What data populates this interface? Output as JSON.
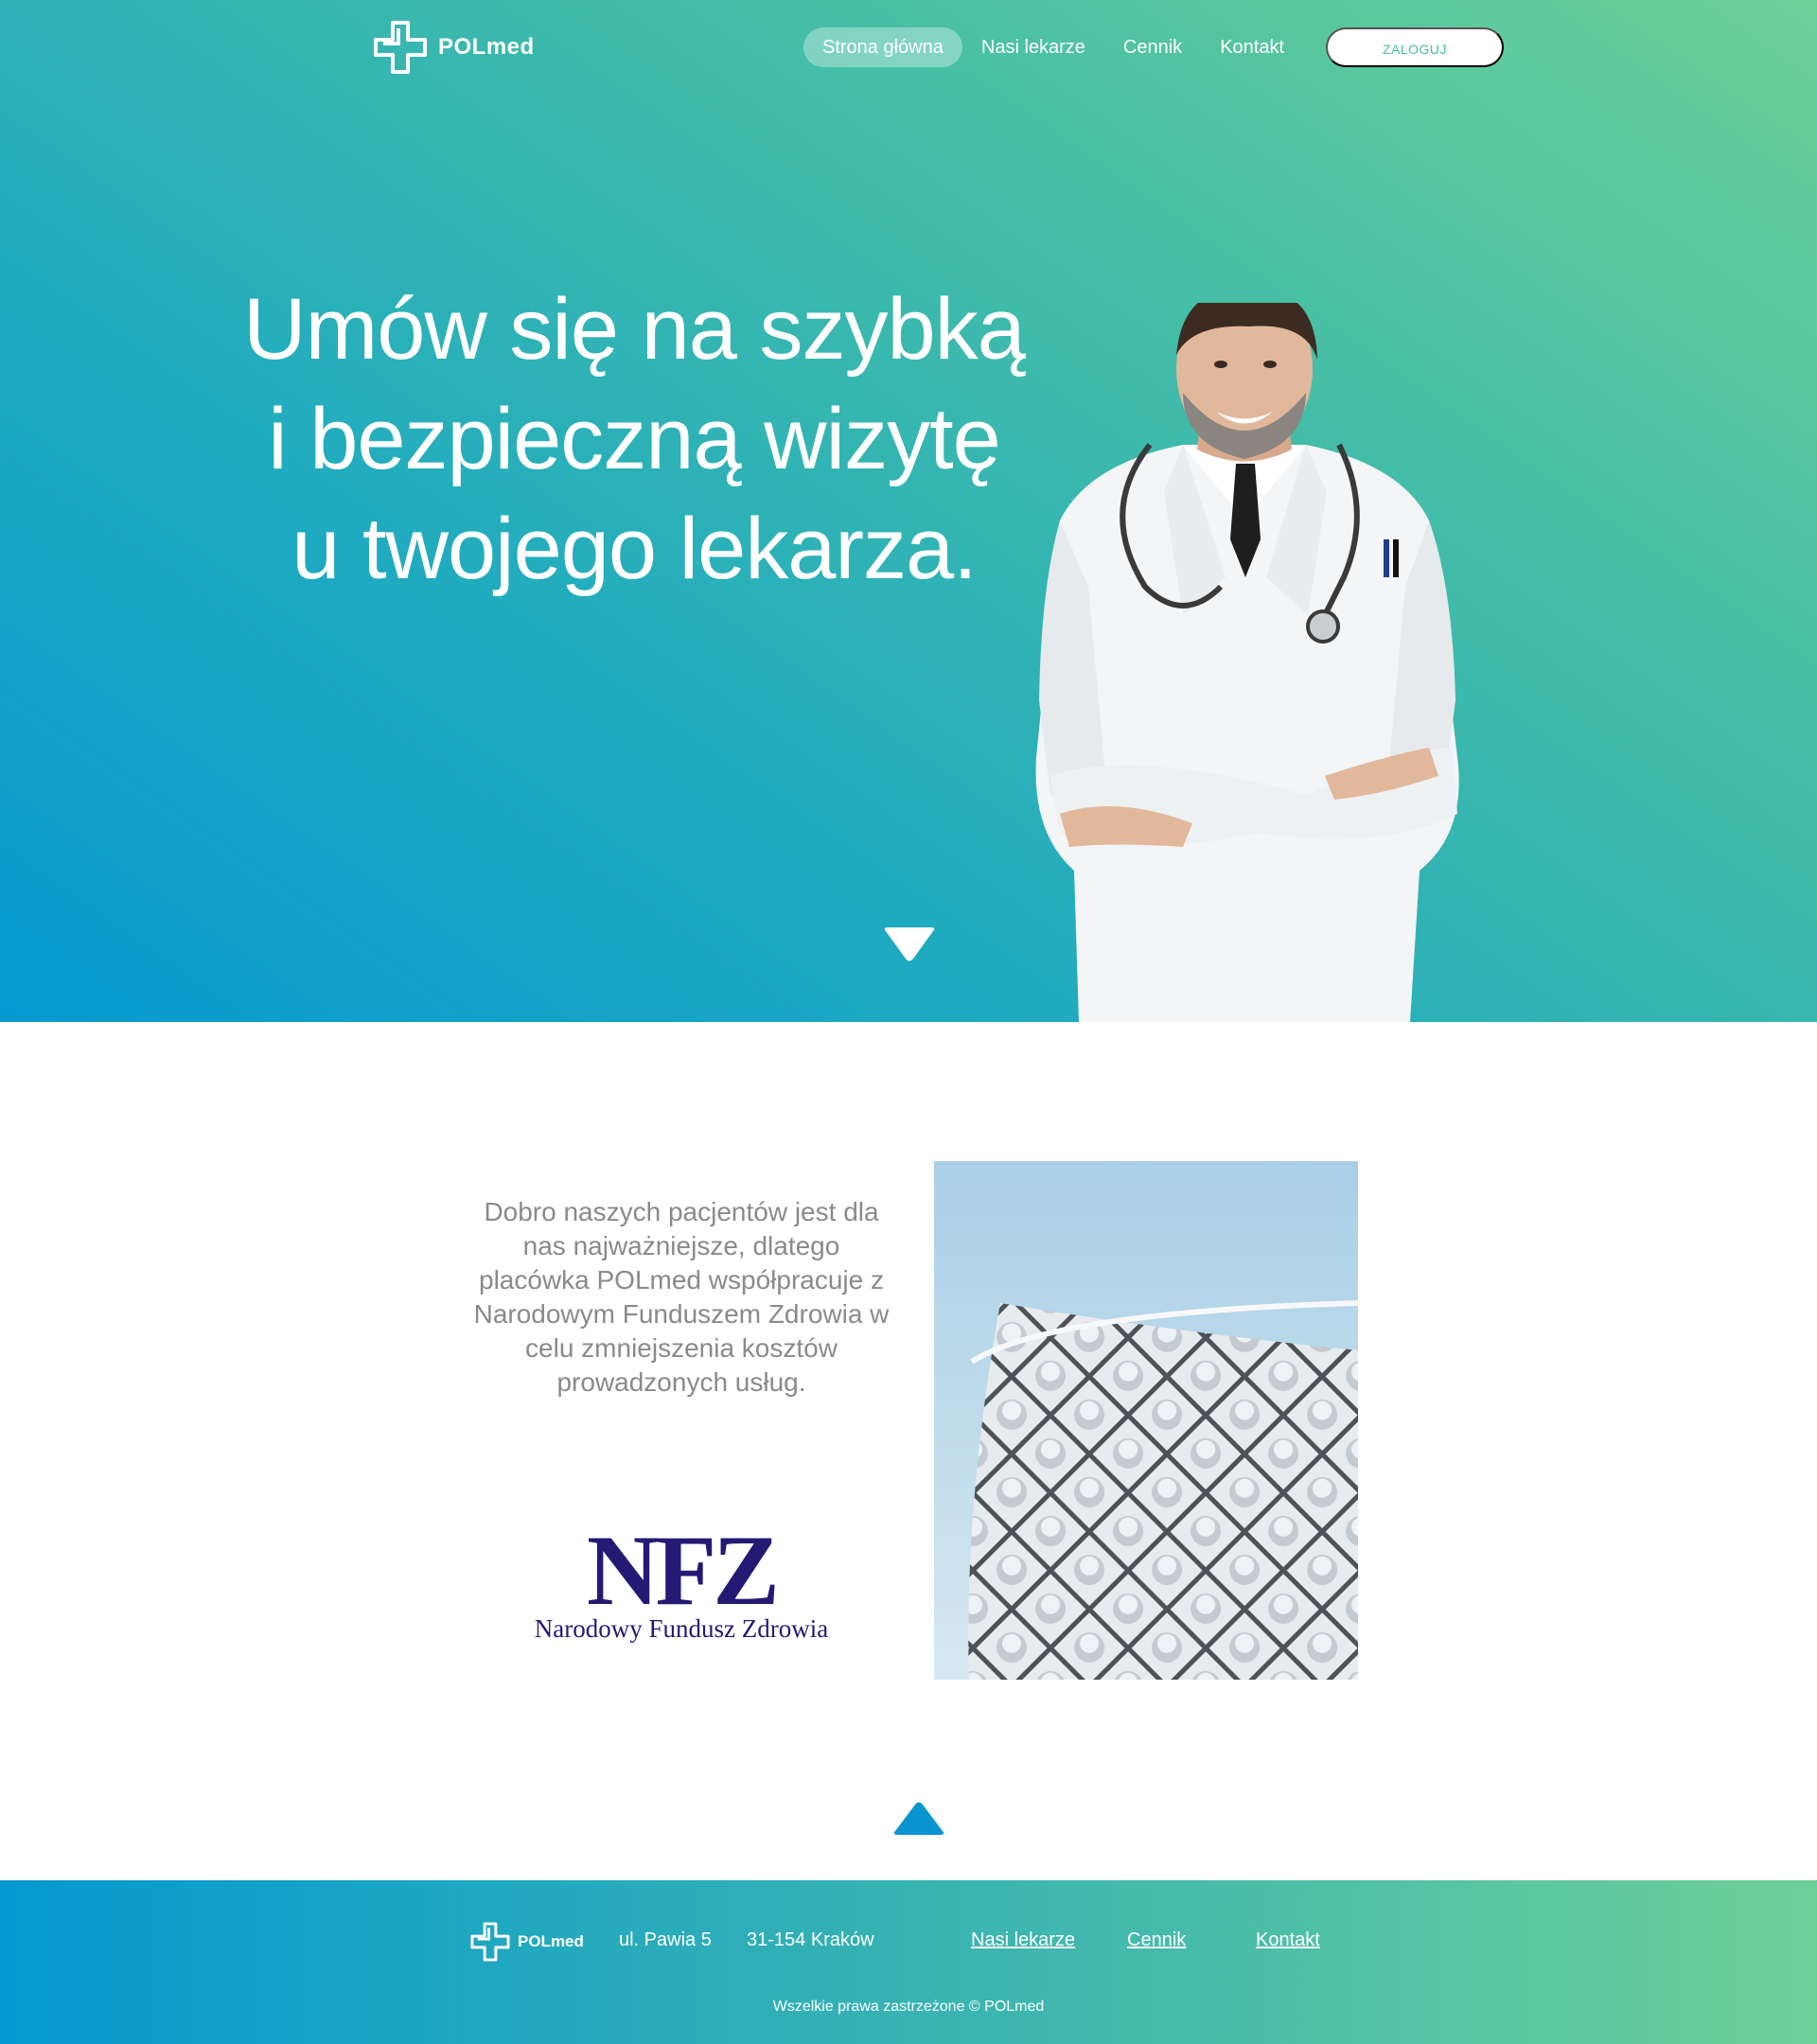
{
  "brand": {
    "name": "POLmed",
    "primary_color": "#0599d0",
    "accent_color": "#6dd097"
  },
  "nav": {
    "items": [
      {
        "label": "Strona główna",
        "active": true
      },
      {
        "label": "Nasi lekarze",
        "active": false
      },
      {
        "label": "Cennik",
        "active": false
      },
      {
        "label": "Kontakt",
        "active": false
      }
    ],
    "login_label": "ZALOGUJ"
  },
  "hero": {
    "title_lines": [
      "Umów się na szybką",
      "i bezpieczną wizytę",
      "u twojego lekarza."
    ],
    "image": "doctor-photo",
    "scroll_icon": "chevron-down-icon"
  },
  "info": {
    "text": "Dobro naszych pacjentów jest dla nas najważniejsze, dlatego placówka POLmed współpracuje z Narodowym Funduszem Zdrowia w celu zmniejszenia kosztów prowadzonych usług.",
    "partner_logo": {
      "letters": "NFZ",
      "subtitle": "Narodowy Fundusz Zdrowia",
      "color": "#241a73"
    },
    "image": "building-photo",
    "scroll_icon": "chevron-up-icon"
  },
  "footer": {
    "brand": "POLmed",
    "street": "ul. Pawia 5",
    "city": "31-154 Kraków",
    "links": [
      "Nasi lekarze",
      "Cennik",
      "Kontakt"
    ],
    "copyright": "Wszelkie prawa zastrzeżone © POLmed"
  }
}
